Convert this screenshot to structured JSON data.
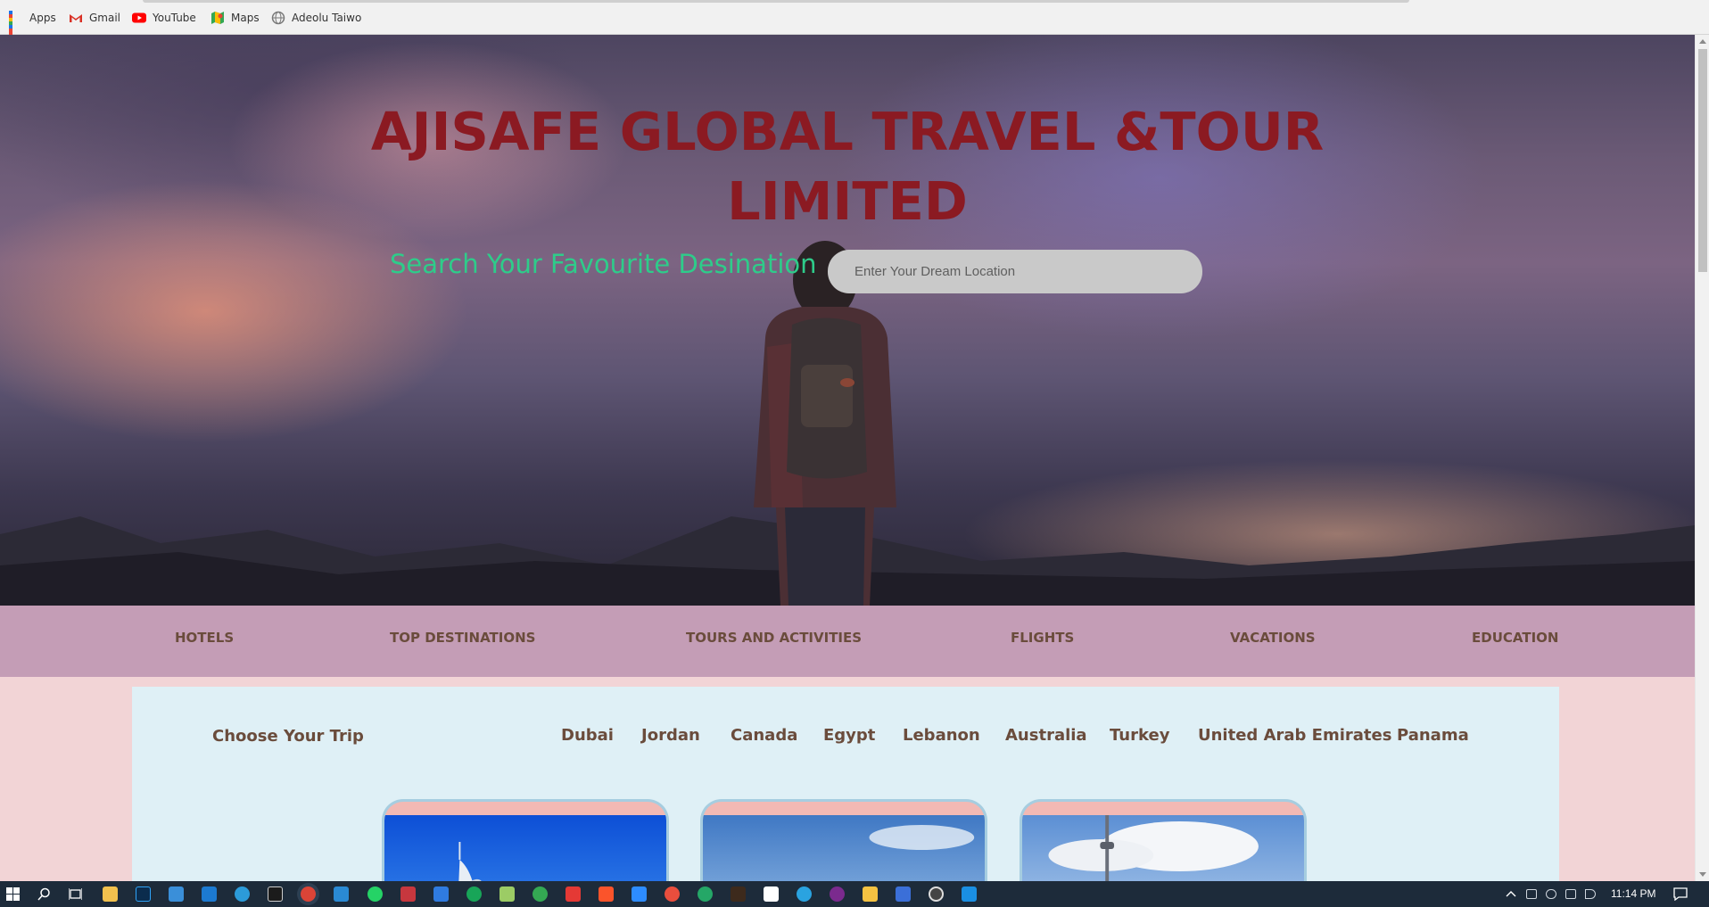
{
  "bookmarks": [
    {
      "label": "Apps",
      "icon": "apps-grid-icon"
    },
    {
      "label": "Gmail",
      "icon": "gmail-icon"
    },
    {
      "label": "YouTube",
      "icon": "youtube-icon"
    },
    {
      "label": "Maps",
      "icon": "maps-icon"
    },
    {
      "label": "Adeolu Taiwo",
      "icon": "globe-icon"
    }
  ],
  "hero": {
    "title_line1": "AJISAFE GLOBAL TRAVEL &TOUR",
    "title_line2": "LIMITED",
    "search_label": "Search Your Favourite Desination",
    "search_placeholder": "Enter Your Dream Location"
  },
  "nav": {
    "items": [
      "HOTELS",
      "TOP DESTINATIONS",
      "TOURS AND ACTIVITIES",
      "FLIGHTS",
      "VACATIONS",
      "EDUCATION"
    ]
  },
  "trip": {
    "title": "Choose Your Trip",
    "countries": [
      "Dubai",
      "Jordan",
      "Canada",
      "Egypt",
      "Lebanon",
      "Australia",
      "Turkey",
      "United Arab Emirates",
      "Panama"
    ],
    "cards": [
      {
        "name": "dubai-card",
        "icon": "burj-al-arab-photo"
      },
      {
        "name": "sydney-card",
        "icon": "opera-house-photo"
      },
      {
        "name": "toronto-card",
        "icon": "cn-tower-photo"
      }
    ]
  },
  "taskbar": {
    "time": "11:14 PM"
  },
  "colors": {
    "title": "#8b1a22",
    "search_label": "#2ecc8a",
    "nav_bg": "#c49db6",
    "nav_text": "#6a4c3c",
    "page_bg": "#f2d4d6",
    "trip_bg": "#dff0f6"
  }
}
